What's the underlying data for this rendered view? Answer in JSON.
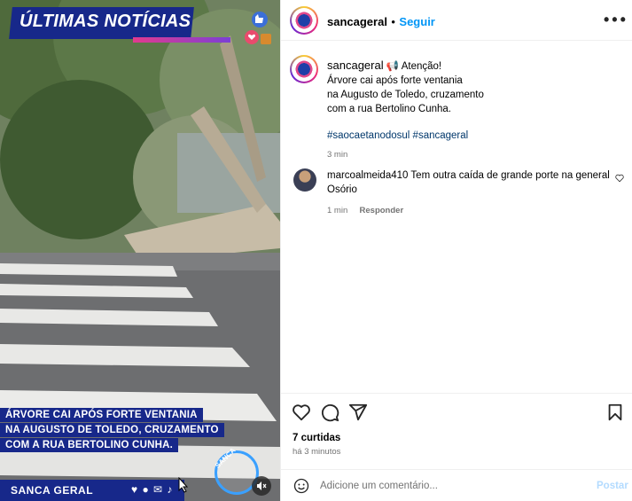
{
  "media": {
    "banner_title": "ÚLTIMAS NOTÍCIAS",
    "caption_lines": [
      "ÁRVORE CAI APÓS FORTE VENTANIA",
      "NA AUGUSTO DE TOLEDO, CRUZAMENTO",
      "COM A RUA BERTOLINO CUNHA."
    ],
    "brand": "SANCA GERAL",
    "logo_text": "SANCA",
    "mute_icon": "speaker-muted-icon"
  },
  "post": {
    "username": "sancageral",
    "follow_label": "Seguir",
    "dot": "•",
    "more_icon": "more-options-icon",
    "caption": {
      "emoji": "📢",
      "lines": [
        "Atenção!",
        "Árvore cai após forte ventania",
        "na Augusto de Toledo, cruzamento",
        "com a rua Bertolino Cunha."
      ],
      "hashtags": "#saocaetanodosul #sancageral",
      "age": "3 min"
    },
    "comment": {
      "username": "marcoalmeida410",
      "text": "Tem outra caída de grande porte na general Osório",
      "age": "1 min",
      "reply_label": "Responder"
    },
    "likes": "7 curtidas",
    "time": "há 3 minutos",
    "comment_placeholder": "Adicione um comentário...",
    "post_label": "Postar"
  }
}
